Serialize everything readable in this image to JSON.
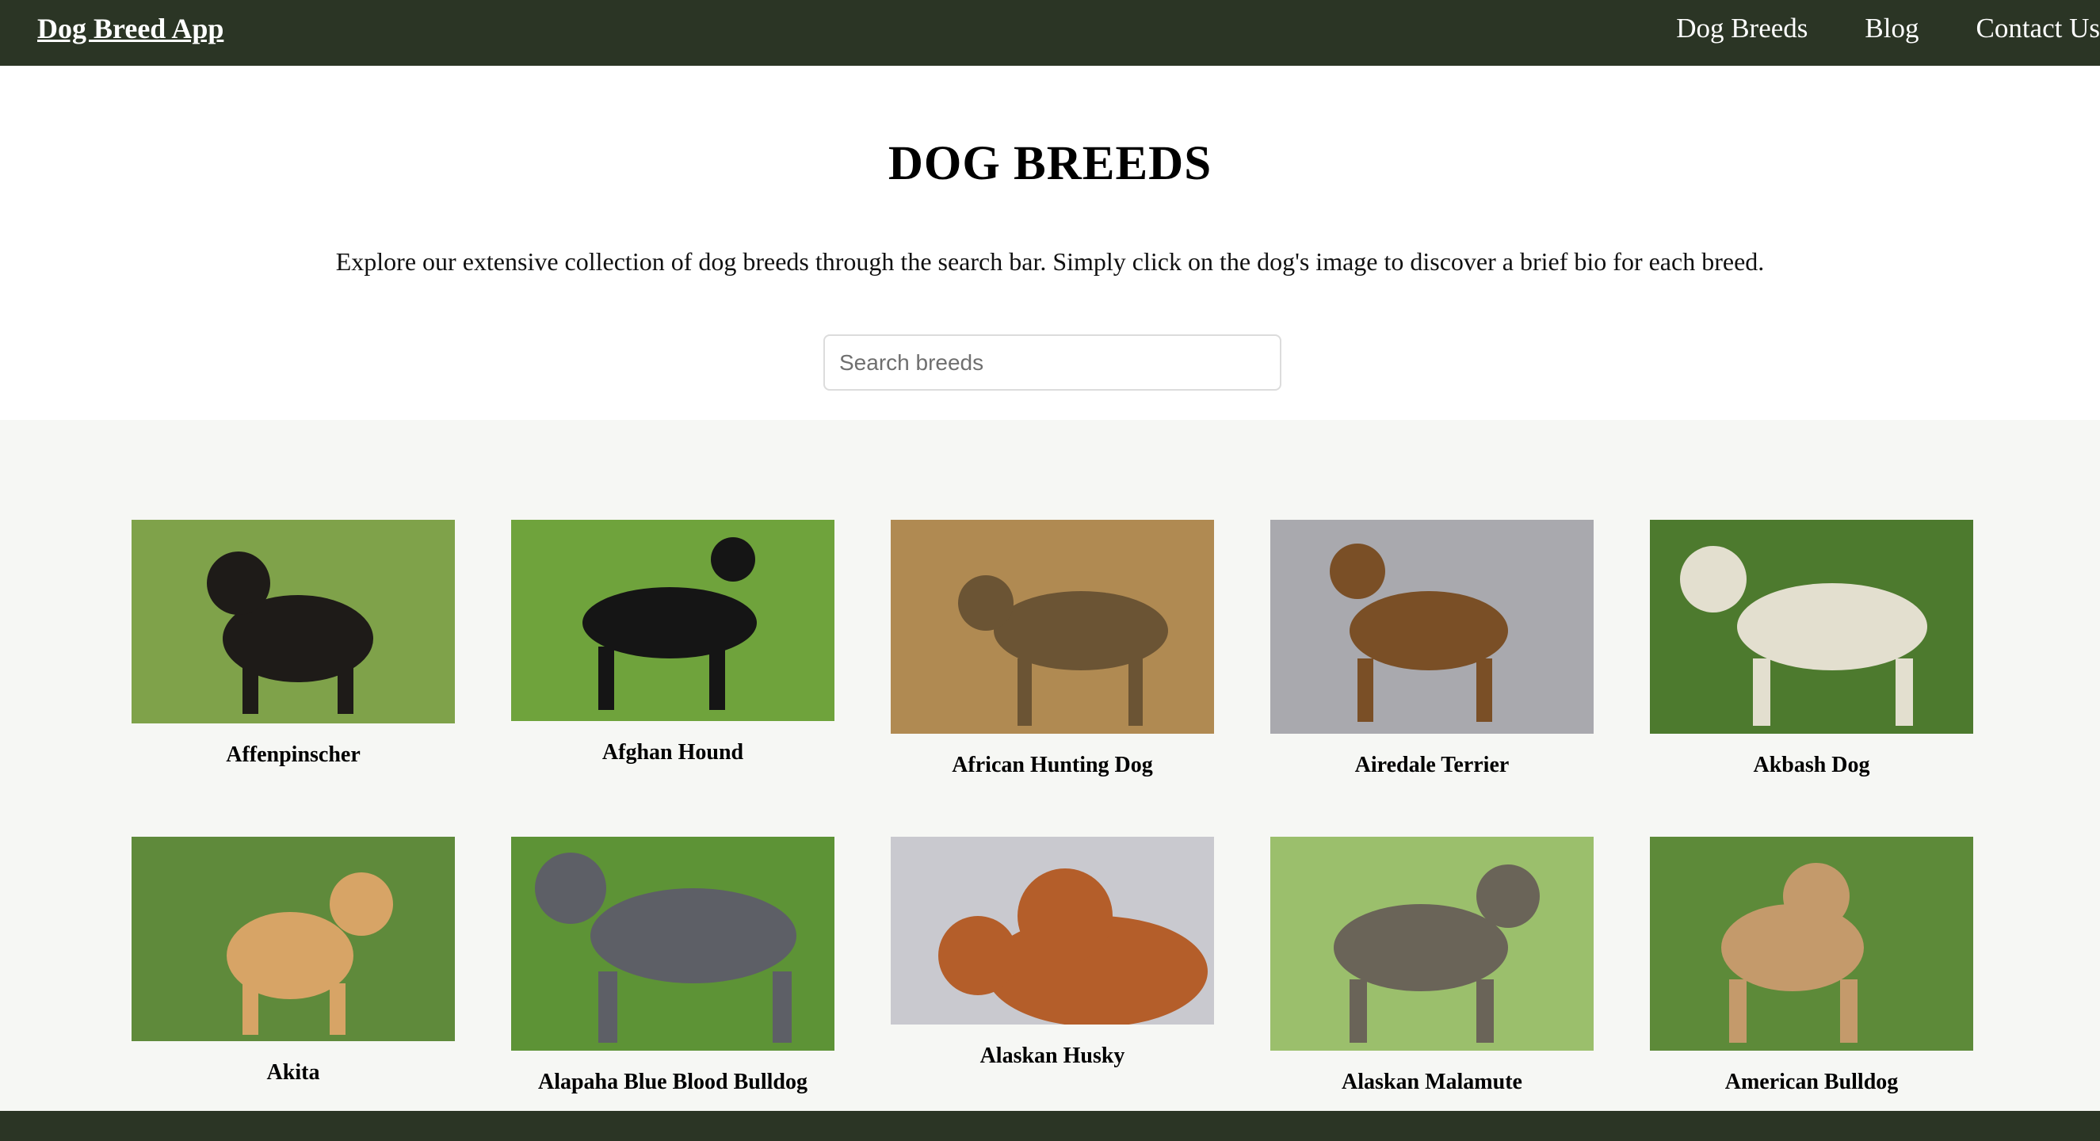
{
  "nav": {
    "brand": "Dog Breed App",
    "links": [
      "Dog Breeds",
      "Blog",
      "Contact Us"
    ]
  },
  "hero": {
    "title": "DOG BREEDS",
    "intro": "Explore our extensive collection of dog breeds through the search bar. Simply click on the dog's image to discover a brief bio for each breed."
  },
  "search": {
    "placeholder": "Search breeds",
    "value": ""
  },
  "breeds": [
    {
      "name": "Affenpinscher",
      "bg": "#7fa24a",
      "dog": "#1e1b18"
    },
    {
      "name": "Afghan Hound",
      "bg": "#6fa33c",
      "dog": "#151515"
    },
    {
      "name": "African Hunting Dog",
      "bg": "#b08a52",
      "dog": "#6b5434"
    },
    {
      "name": "Airedale Terrier",
      "bg": "#a9a9ae",
      "dog": "#7a4f26"
    },
    {
      "name": "Akbash Dog",
      "bg": "#4d7a2e",
      "dog": "#e3dfcf"
    },
    {
      "name": "Akita",
      "bg": "#5f8a3b",
      "dog": "#d7a466"
    },
    {
      "name": "Alapaha Blue Blood Bulldog",
      "bg": "#5d9336",
      "dog": "#5d5f66"
    },
    {
      "name": "Alaskan Husky",
      "bg": "#c9c9cf",
      "dog": "#b45e2a"
    },
    {
      "name": "Alaskan Malamute",
      "bg": "#9bbf6c",
      "dog": "#6a6458"
    },
    {
      "name": "American Bulldog",
      "bg": "#5d8a39",
      "dog": "#c49a6b"
    }
  ]
}
